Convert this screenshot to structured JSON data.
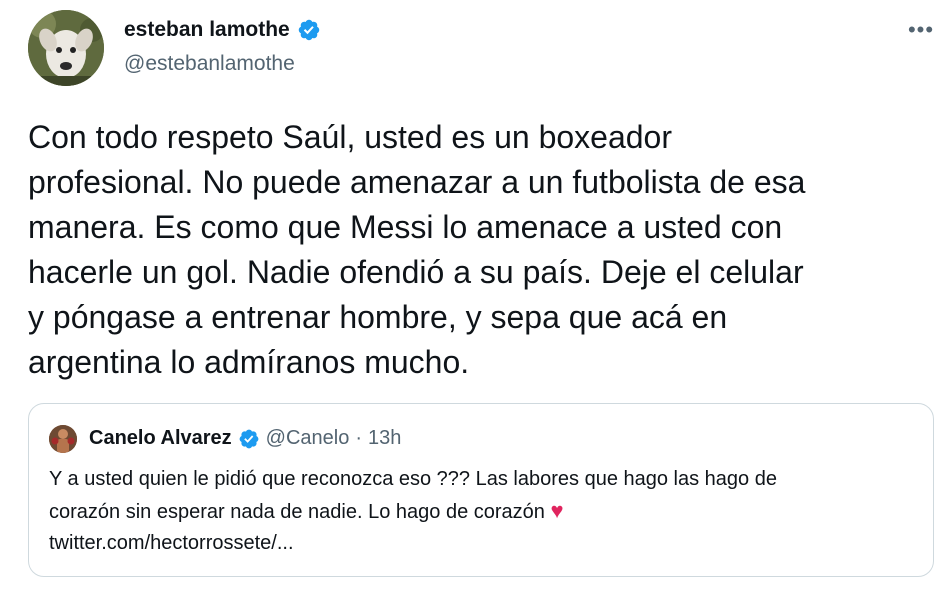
{
  "author": {
    "name": "esteban lamothe",
    "handle": "@estebanlamothe"
  },
  "more_label": "•••",
  "tweet": {
    "text": "Con todo respeto Saúl, usted es un boxeador\nprofesional. No puede amenazar a un futbolista de esa\nmanera. Es como que Messi lo amenace a usted con\nhacerle un gol. Nadie ofendió a su país. Deje el celular\ny póngase a entrenar hombre, y sepa que acá en\nargentina lo admíranos mucho."
  },
  "quoted": {
    "name": "Canelo Alvarez",
    "handle": "@Canelo",
    "separator": "·",
    "time": "13h",
    "text": "Y a usted quien le pidió que reconozca eso ??? Las labores que hago las hago de\ncorazón sin esperar nada de nadie. Lo hago de corazón",
    "heart": "♥",
    "link": "twitter.com/hectorrossete/..."
  },
  "colors": {
    "verified": "#1d9bf0",
    "secondary_text": "#536471",
    "heart": "#e0245e",
    "border": "#cfd9de"
  },
  "icons": [
    "verified-badge-icon",
    "more-options-icon",
    "heart-icon"
  ]
}
